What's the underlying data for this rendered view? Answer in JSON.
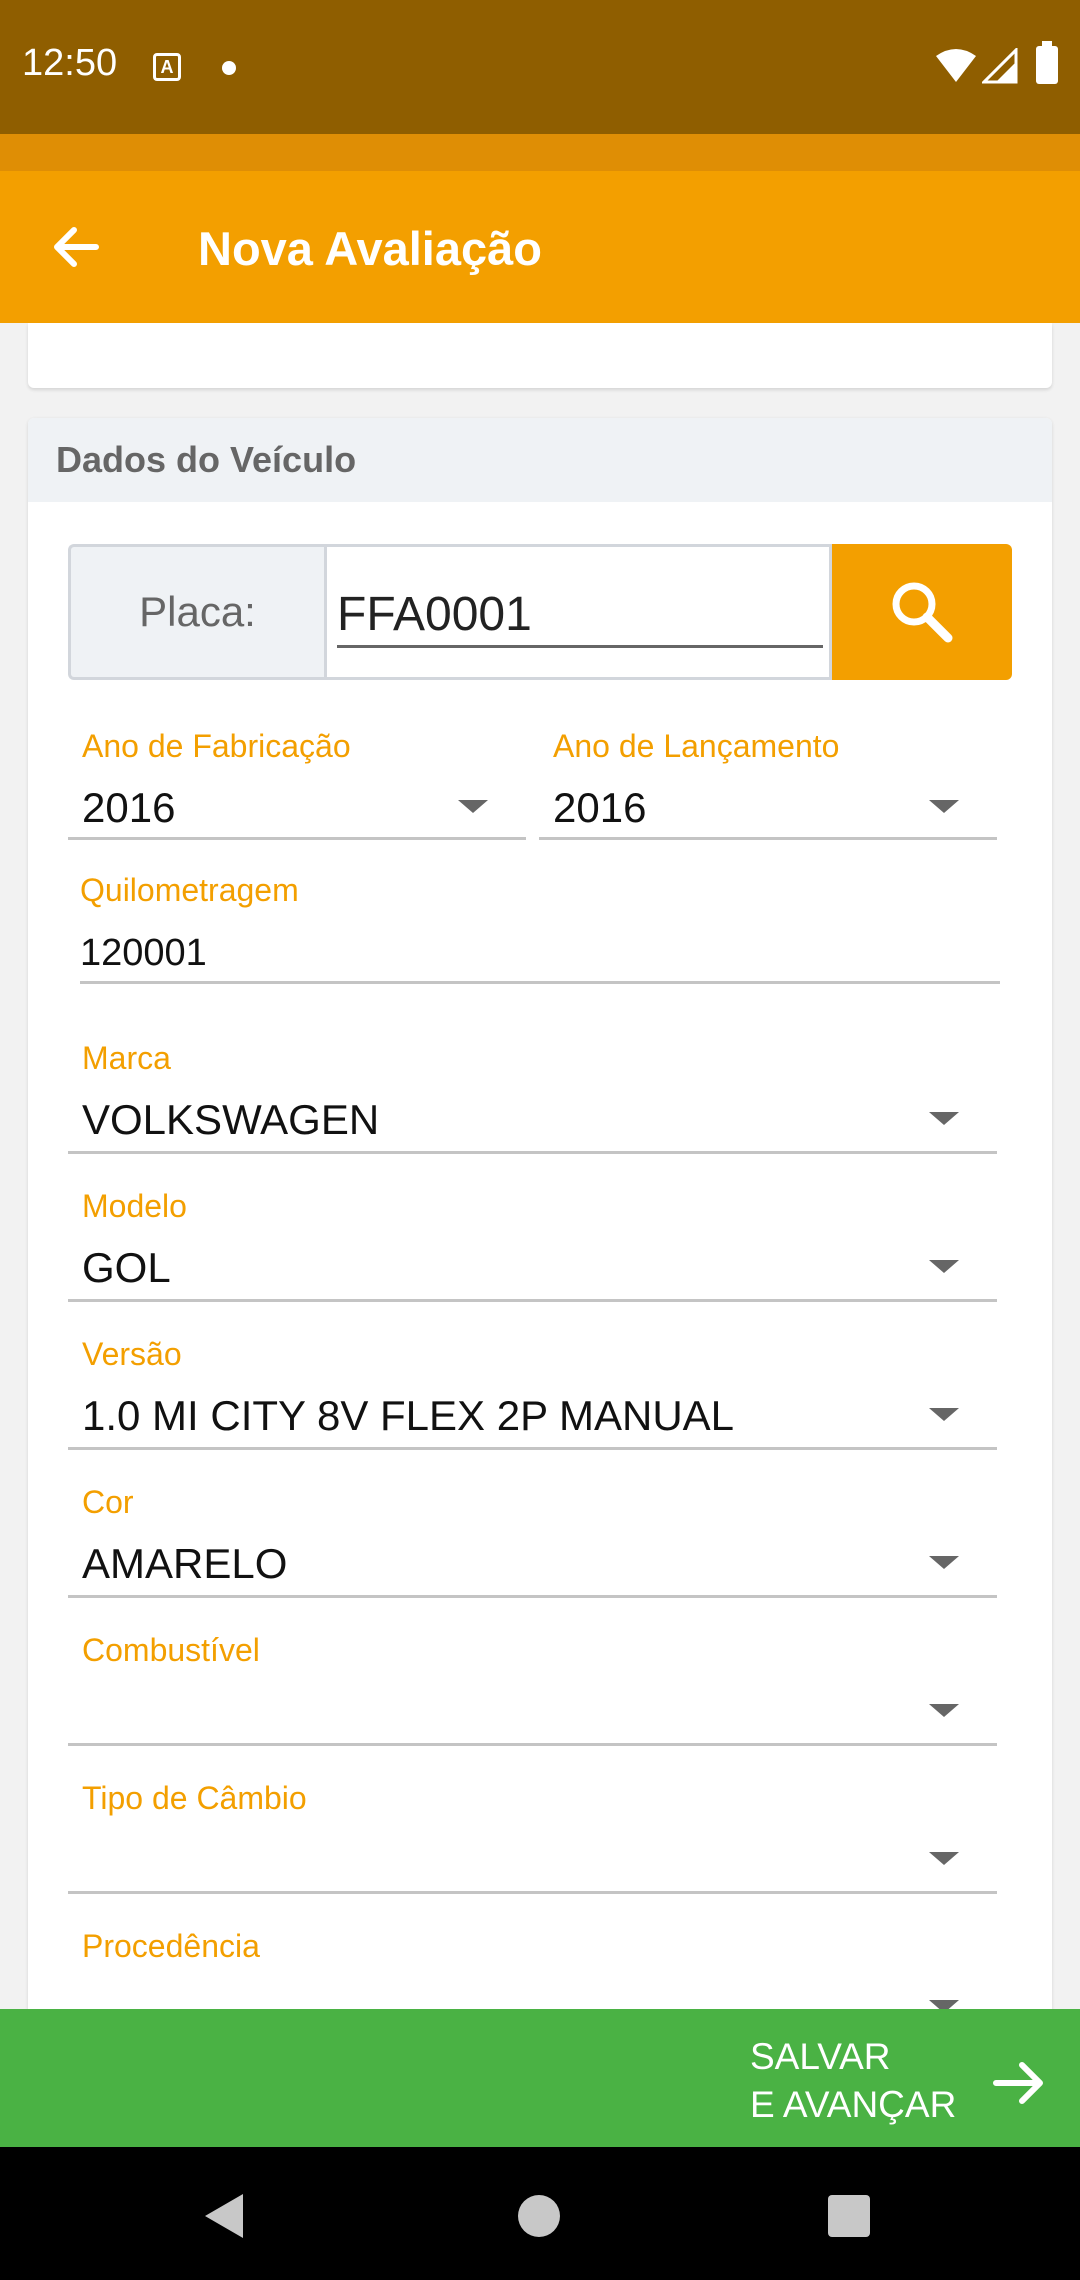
{
  "status_bar": {
    "time": "12:50",
    "notification_icon": "A"
  },
  "app_bar": {
    "title": "Nova Avaliação",
    "back_icon": "arrow-left-icon"
  },
  "section": {
    "title": "Dados do Veículo"
  },
  "plate": {
    "label": "Placa:",
    "value": "FFA0001",
    "search_icon": "search-icon"
  },
  "fields": {
    "ano_fabricacao": {
      "label": "Ano de Fabricação",
      "value": "2016"
    },
    "ano_lancamento": {
      "label": "Ano de Lançamento",
      "value": "2016"
    },
    "quilometragem": {
      "label": "Quilometragem",
      "value": "120001"
    },
    "marca": {
      "label": "Marca",
      "value": "VOLKSWAGEN"
    },
    "modelo": {
      "label": "Modelo",
      "value": "GOL"
    },
    "versao": {
      "label": "Versão",
      "value": "1.0 MI CITY 8V FLEX 2P MANUAL"
    },
    "cor": {
      "label": "Cor",
      "value": "AMARELO"
    },
    "combustivel": {
      "label": "Combustível",
      "value": ""
    },
    "tipo_cambio": {
      "label": "Tipo de Câmbio",
      "value": ""
    },
    "procedencia": {
      "label": "Procedência",
      "value": ""
    }
  },
  "action": {
    "label": "SALVAR\nE AVANÇAR",
    "icon": "arrow-right-icon"
  },
  "colors": {
    "primary": "#f39f00",
    "status_bar": "#8f5e00",
    "action": "#4ab244"
  }
}
